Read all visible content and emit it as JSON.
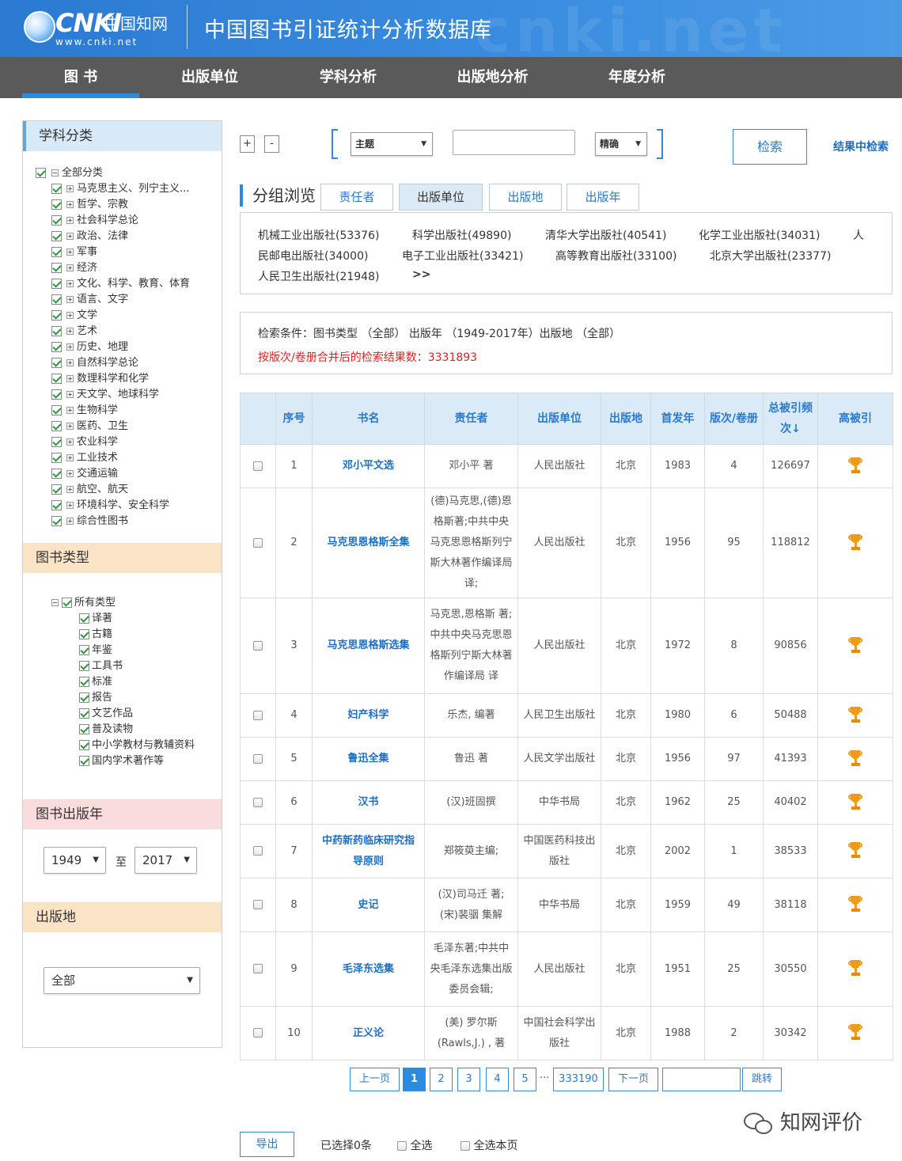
{
  "header": {
    "logo_brand": "CNKI",
    "logo_cn": "中国知网",
    "logo_url": "www.cnki.net",
    "title": "中国图书引证统计分析数据库",
    "watermark": "cnki.net"
  },
  "nav": [
    "图  书",
    "出版单位",
    "学科分析",
    "出版地分析",
    "年度分析"
  ],
  "sidebar": {
    "subject_title": "学科分类",
    "subject_root": "全部分类",
    "subjects": [
      "马克思主义、列宁主义...",
      "哲学、宗教",
      "社会科学总论",
      "政治、法律",
      "军事",
      "经济",
      "文化、科学、教育、体育",
      "语言、文字",
      "文学",
      "艺术",
      "历史、地理",
      "自然科学总论",
      "数理科学和化学",
      "天文学、地球科学",
      "生物科学",
      "医药、卫生",
      "农业科学",
      "工业技术",
      "交通运输",
      "航空、航天",
      "环境科学、安全科学",
      "综合性图书"
    ],
    "type_title": "图书类型",
    "type_root": "所有类型",
    "types": [
      "译著",
      "古籍",
      "年鉴",
      "工具书",
      "标准",
      "报告",
      "文艺作品",
      "普及读物",
      "中小学教材与教辅资料",
      "国内学术著作等"
    ],
    "year_title": "图书出版年",
    "year_from": "1949",
    "year_to_label": "至",
    "year_to": "2017",
    "place_title": "出版地",
    "place_value": "全部"
  },
  "search": {
    "plus": "+",
    "minus": "-",
    "field": "主题",
    "match": "精确",
    "button": "检索",
    "in_results": "结果中检索"
  },
  "group": {
    "title": "分组浏览",
    "tabs": [
      "责任者",
      "出版单位",
      "出版地",
      "出版年"
    ],
    "publishers_row1": [
      "机械工业出版社(53376)",
      "科学出版社(49890)",
      "清华大学出版社(40541)",
      "化学工业出版社(34031)",
      "人"
    ],
    "publishers_row2": [
      "民邮电出版社(34000)",
      "电子工业出版社(33421)",
      "高等教育出版社(33100)",
      "北京大学出版社(23377)"
    ],
    "publishers_row3": [
      "人民卫生出版社(21948)"
    ],
    "more": ">>"
  },
  "conditions": {
    "line1": "检索条件：图书类型 （全部） 出版年 （1949-2017年）出版地 （全部）",
    "line2_label": "按版次/卷册合并后的检索结果数：",
    "line2_value": "3331893",
    "accent_color": "#e02020"
  },
  "table": {
    "headers": [
      "序号",
      "书名",
      "责任者",
      "出版单位",
      "出版地",
      "首发年",
      "版次/卷册",
      "总被引频次↓",
      "高被引"
    ],
    "rows": [
      {
        "no": "1",
        "title": "邓小平文选",
        "author": "邓小平 著",
        "publisher": "人民出版社",
        "place": "北京",
        "year": "1983",
        "editions": "4",
        "cites": "126697"
      },
      {
        "no": "2",
        "title": "马克思恩格斯全集",
        "author": "(德)马克思,(德)恩格斯著;中共中央马克思恩格斯列宁斯大林著作编译局译;",
        "publisher": "人民出版社",
        "place": "北京",
        "year": "1956",
        "editions": "95",
        "cites": "118812"
      },
      {
        "no": "3",
        "title": "马克思恩格斯选集",
        "author": "马克思,恩格斯 著;中共中央马克思恩格斯列宁斯大林著作编译局 译",
        "publisher": "人民出版社",
        "place": "北京",
        "year": "1972",
        "editions": "8",
        "cites": "90856"
      },
      {
        "no": "4",
        "title": "妇产科学",
        "author": "乐杰, 编著",
        "publisher": "人民卫生出版社",
        "place": "北京",
        "year": "1980",
        "editions": "6",
        "cites": "50488"
      },
      {
        "no": "5",
        "title": "鲁迅全集",
        "author": "鲁迅 著",
        "publisher": "人民文学出版社",
        "place": "北京",
        "year": "1956",
        "editions": "97",
        "cites": "41393"
      },
      {
        "no": "6",
        "title": "汉书",
        "author": "(汉)班固撰",
        "publisher": "中华书局",
        "place": "北京",
        "year": "1962",
        "editions": "25",
        "cites": "40402"
      },
      {
        "no": "7",
        "title": "中药新药临床研究指导原则",
        "author": "郑筱萸主编;",
        "publisher": "中国医药科技出版社",
        "place": "北京",
        "year": "2002",
        "editions": "1",
        "cites": "38533"
      },
      {
        "no": "8",
        "title": "史记",
        "author": "(汉)司马迁 著;(宋)裴骃 集解",
        "publisher": "中华书局",
        "place": "北京",
        "year": "1959",
        "editions": "49",
        "cites": "38118"
      },
      {
        "no": "9",
        "title": "毛泽东选集",
        "author": "毛泽东著;中共中央毛泽东选集出版委员会辑;",
        "publisher": "人民出版社",
        "place": "北京",
        "year": "1951",
        "editions": "25",
        "cites": "30550"
      },
      {
        "no": "10",
        "title": "正义论",
        "author": "(美) 罗尔斯(Rawls,J.) , 著",
        "publisher": "中国社会科学出版社",
        "place": "北京",
        "year": "1988",
        "editions": "2",
        "cites": "30342"
      }
    ]
  },
  "pagination": {
    "prev": "上一页",
    "pages": [
      "1",
      "2",
      "3",
      "4",
      "5"
    ],
    "ellipsis": "...",
    "last": "333190",
    "next": "下一页",
    "jump": "跳转"
  },
  "footer": {
    "export": "导出",
    "selected": "已选择0条",
    "select_all": "全选",
    "select_page": "全选本页",
    "watermark": "知网评价"
  }
}
